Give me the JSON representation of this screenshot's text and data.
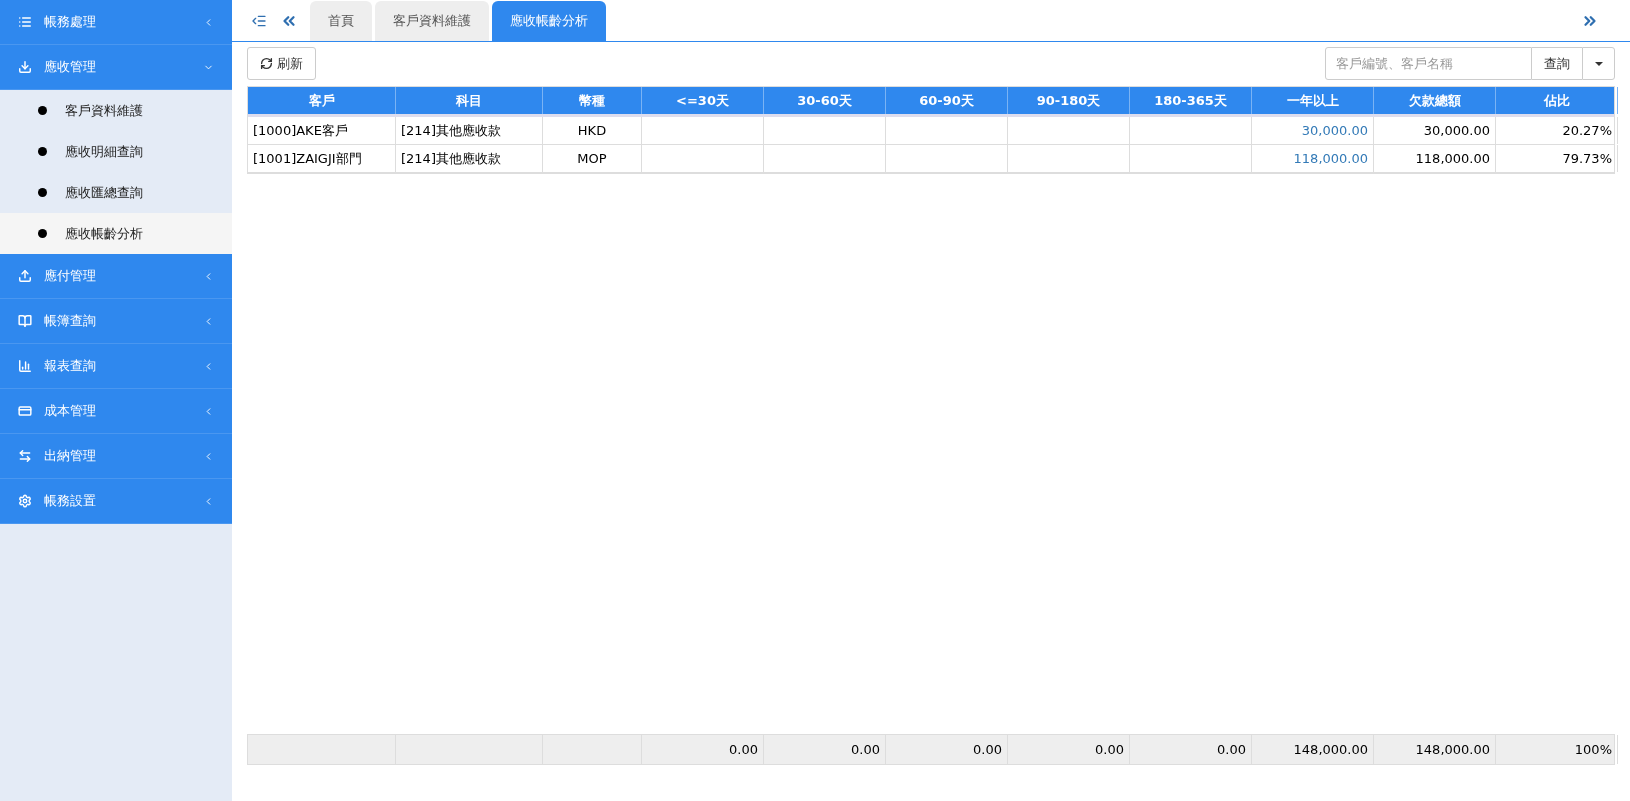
{
  "sidebar": {
    "groups": [
      {
        "label": "帳務處理",
        "expanded": false
      },
      {
        "label": "應收管理",
        "expanded": true,
        "children": [
          {
            "label": "客戶資料維護",
            "selected": false
          },
          {
            "label": "應收明細查詢",
            "selected": false
          },
          {
            "label": "應收匯總查詢",
            "selected": false
          },
          {
            "label": "應收帳齡分析",
            "selected": true
          }
        ]
      },
      {
        "label": "應付管理",
        "expanded": false
      },
      {
        "label": "帳簿查詢",
        "expanded": false
      },
      {
        "label": "報表查詢",
        "expanded": false
      },
      {
        "label": "成本管理",
        "expanded": false
      },
      {
        "label": "出納管理",
        "expanded": false
      },
      {
        "label": "帳務設置",
        "expanded": false
      }
    ]
  },
  "tabs": [
    {
      "label": "首頁",
      "selected": false
    },
    {
      "label": "客戶資料維護",
      "selected": false
    },
    {
      "label": "應收帳齡分析",
      "selected": true
    }
  ],
  "toolbar": {
    "refresh": "刷新",
    "search": {
      "placeholder": "客戶編號、客戶名稱"
    },
    "query": "查詢"
  },
  "table": {
    "columns": [
      {
        "label": "客戶",
        "kind": "text"
      },
      {
        "label": "科目",
        "kind": "text"
      },
      {
        "label": "幣種",
        "kind": "code"
      },
      {
        "label": "<=30天",
        "kind": "amount"
      },
      {
        "label": "30-60天",
        "kind": "amount"
      },
      {
        "label": "60-90天",
        "kind": "amount"
      },
      {
        "label": "90-180天",
        "kind": "amount"
      },
      {
        "label": "180-365天",
        "kind": "amount"
      },
      {
        "label": "一年以上",
        "kind": "link"
      },
      {
        "label": "欠款總額",
        "kind": "amount"
      },
      {
        "label": "佔比",
        "kind": "amount"
      }
    ],
    "rows": [
      [
        "[1000]AKE客戶",
        "[214]其他應收款",
        "HKD",
        null,
        null,
        null,
        null,
        null,
        "30,000.00",
        "30,000.00",
        "20.27%"
      ],
      [
        "[1001]ZAIGJI部門",
        "[214]其他應收款",
        "MOP",
        null,
        null,
        null,
        null,
        null,
        "118,000.00",
        "118,000.00",
        "79.73%"
      ]
    ],
    "totals": [
      "0.00",
      "0.00",
      "0.00",
      "0.00",
      "0.00",
      "148,000.00",
      "148,000.00",
      "100%"
    ]
  }
}
